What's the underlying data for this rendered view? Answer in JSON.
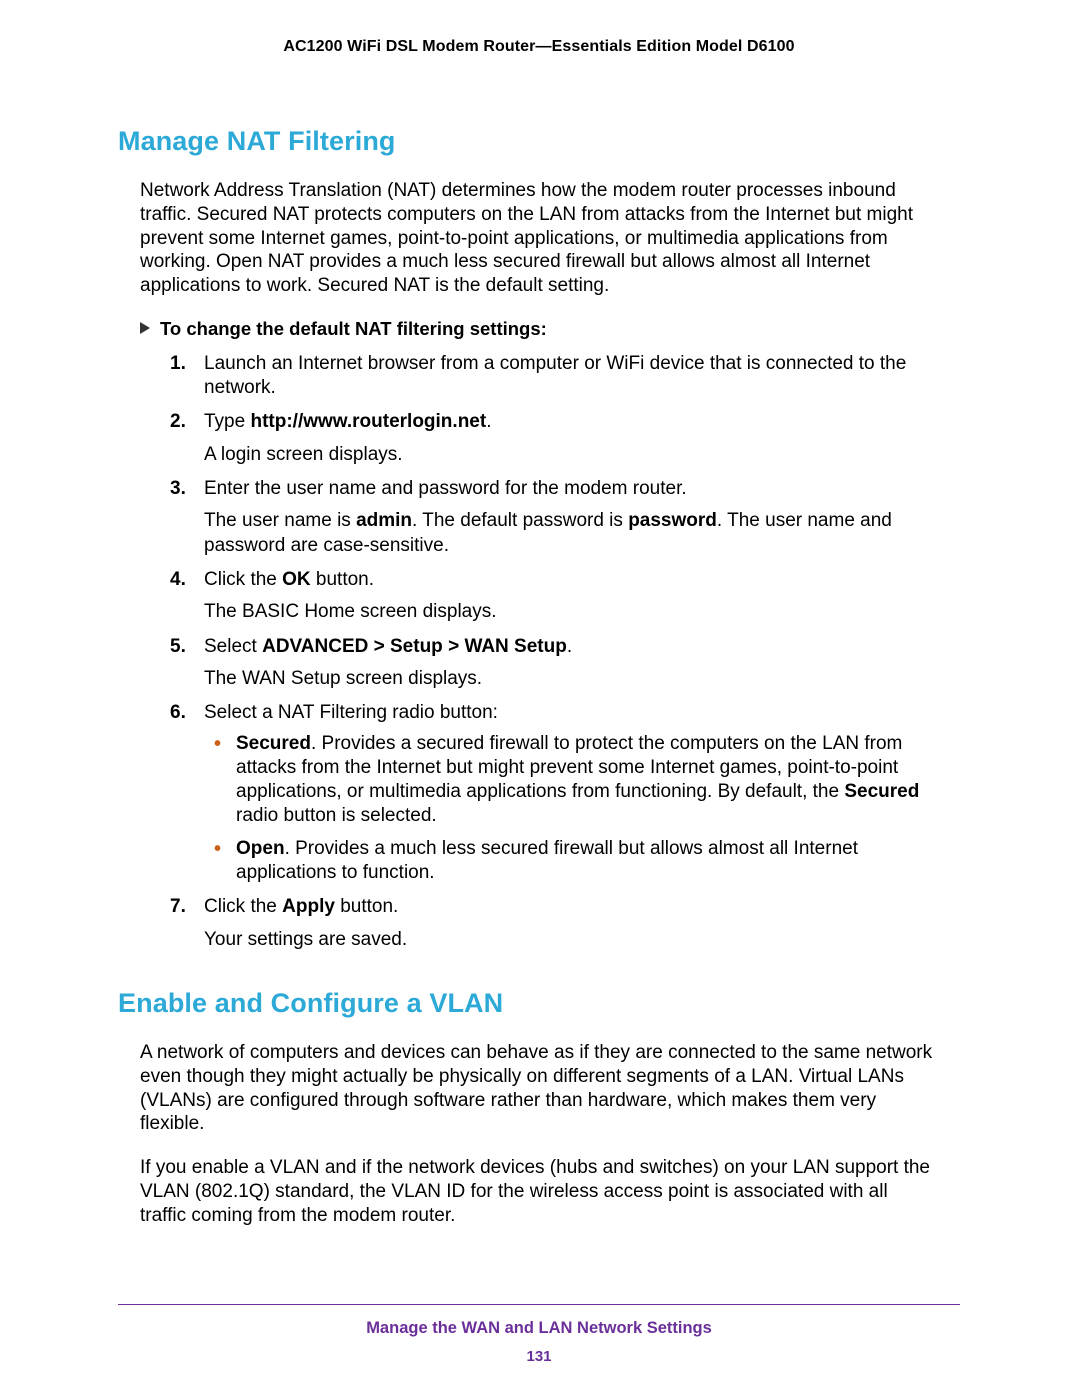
{
  "header": "AC1200 WiFi DSL Modem Router—Essentials Edition Model D6100",
  "section1": {
    "title": "Manage NAT Filtering",
    "intro": "Network Address Translation (NAT) determines how the modem router processes inbound traffic. Secured NAT protects computers on the LAN from attacks from the Internet but might prevent some Internet games, point-to-point applications, or multimedia applications from working. Open NAT provides a much less secured firewall but allows almost all Internet applications to work. Secured NAT is the default setting.",
    "instruction_heading": "To change the default NAT filtering settings:",
    "steps": {
      "s1": "Launch an Internet browser from a computer or WiFi device that is connected to the network.",
      "s2_pre": "Type ",
      "s2_bold": "http://www.routerlogin.net",
      "s2_post": ".",
      "s2_after": "A login screen displays.",
      "s3": "Enter the user name and password for the modem router.",
      "s3_after_a": "The user name is ",
      "s3_after_b": "admin",
      "s3_after_c": ". The default password is ",
      "s3_after_d": "password",
      "s3_after_e": ". The user name and password are case-sensitive.",
      "s4_pre": "Click the ",
      "s4_bold": "OK",
      "s4_post": " button.",
      "s4_after": "The BASIC Home screen displays.",
      "s5_pre": "Select ",
      "s5_bold": "ADVANCED > Setup > WAN Setup",
      "s5_post": ".",
      "s5_after": "The WAN Setup screen displays.",
      "s6": "Select a NAT Filtering radio button:",
      "s6_b1_label": "Secured",
      "s6_b1_text_a": ". Provides a secured firewall to protect the computers on the LAN from attacks from the Internet but might prevent some Internet games, point-to-point applications, or multimedia applications from functioning. By default, the ",
      "s6_b1_text_b": "Secured",
      "s6_b1_text_c": " radio button is selected.",
      "s6_b2_label": "Open",
      "s6_b2_text": ". Provides a much less secured firewall but allows almost all Internet applications to function.",
      "s7_pre": "Click the ",
      "s7_bold": "Apply",
      "s7_post": " button.",
      "s7_after": "Your settings are saved."
    }
  },
  "section2": {
    "title": "Enable and Configure a VLAN",
    "p1": "A network of computers and devices can behave as if they are connected to the same network even though they might actually be physically on different segments of a LAN. Virtual LANs (VLANs) are configured through software rather than hardware, which makes them very flexible.",
    "p2": "If you enable a VLAN and if the network devices (hubs and switches) on your LAN support the VLAN (802.1Q) standard, the VLAN ID for the wireless access point is associated with all traffic coming from the modem router."
  },
  "footer": {
    "title": "Manage the WAN and LAN Network Settings",
    "page": "131"
  }
}
